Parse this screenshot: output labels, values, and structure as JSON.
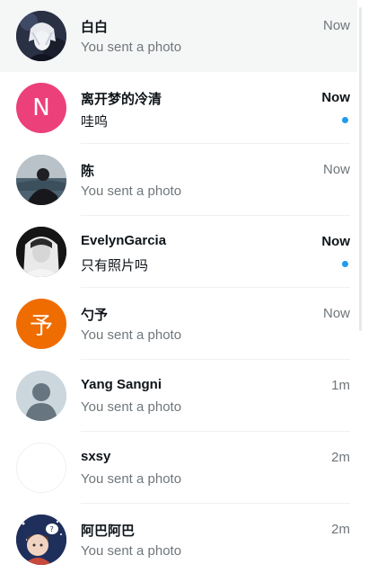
{
  "conversations": [
    {
      "name": "白白",
      "preview": "You sent a photo",
      "time": "Now",
      "unread": false,
      "avatar_kind": "anime-dark",
      "avatar_icon": "anime-avatar-icon"
    },
    {
      "name": "离开梦的冷清",
      "preview": "哇呜",
      "time": "Now",
      "unread": true,
      "avatar_kind": "letter",
      "avatar_letter": "N",
      "avatar_color": "#ec407a"
    },
    {
      "name": "陈",
      "preview": "You sent a photo",
      "time": "Now",
      "unread": false,
      "avatar_kind": "photo-sea",
      "avatar_icon": "person-photo-icon"
    },
    {
      "name": "EvelynGarcia",
      "preview": "只有照片吗",
      "time": "Now",
      "unread": true,
      "avatar_kind": "photo-bw",
      "avatar_icon": "person-photo-icon"
    },
    {
      "name": "勺予",
      "preview": "You sent a photo",
      "time": "Now",
      "unread": false,
      "avatar_kind": "letter",
      "avatar_letter": "予",
      "avatar_color": "#ef6c00"
    },
    {
      "name": "Yang Sangni",
      "preview": "You sent a photo",
      "time": "1m",
      "unread": false,
      "avatar_kind": "default",
      "avatar_icon": "default-avatar-icon"
    },
    {
      "name": "sxsy",
      "preview": "You sent a photo",
      "time": "2m",
      "unread": false,
      "avatar_kind": "blank",
      "avatar_icon": "blank-avatar-icon"
    },
    {
      "name": "阿巴阿巴",
      "preview": "You sent a photo",
      "time": "2m",
      "unread": false,
      "avatar_kind": "anime-night",
      "avatar_icon": "anime-avatar-icon"
    }
  ],
  "colors": {
    "active_row": "#f5f6f6",
    "unread_dot": "#1d9bf0",
    "text_primary": "#0f1419",
    "text_secondary": "#6f767b"
  }
}
